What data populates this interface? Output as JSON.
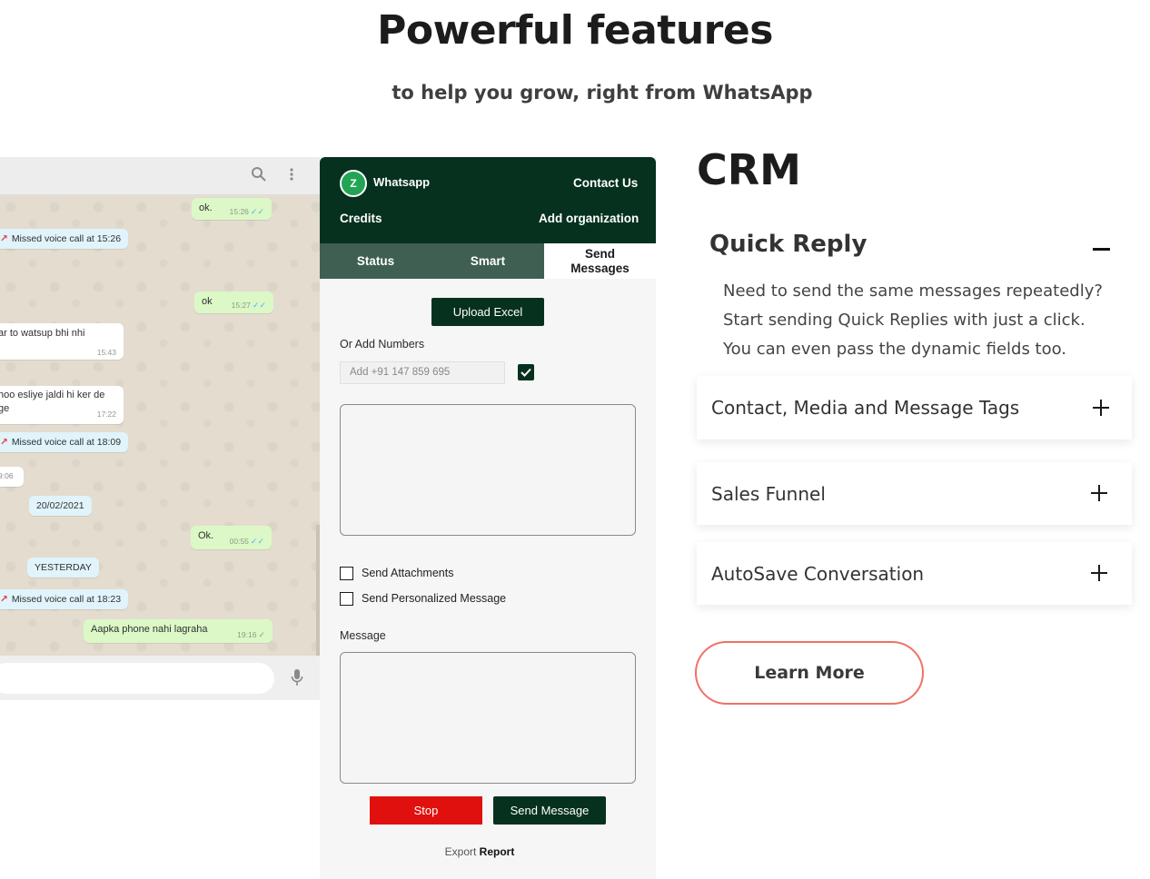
{
  "hero": {
    "title": "Powerful features",
    "subtitle": "to help you grow, right from WhatsApp"
  },
  "chat": {
    "messages": [
      {
        "kind": "out",
        "text": "ok.",
        "time": "15:26"
      },
      {
        "kind": "sys",
        "text": "Missed voice call at 15:26"
      },
      {
        "kind": "out",
        "text": "ok",
        "time": "15:27"
      },
      {
        "kind": "in",
        "text": "ar to watsup bhi nhi",
        "time": "15:43"
      },
      {
        "kind": "in",
        "text": "hoo esliye jaldi hi ker de",
        "text2": "ge",
        "time": "17:22"
      },
      {
        "kind": "sys",
        "text": "Missed voice call at 18:09"
      },
      {
        "kind": "in",
        "text": "9:06"
      },
      {
        "kind": "date",
        "text": "20/02/2021"
      },
      {
        "kind": "out",
        "text": "Ok.",
        "time": "00:55"
      },
      {
        "kind": "date",
        "text": "YESTERDAY"
      },
      {
        "kind": "sys",
        "text": "Missed voice call at 18:23"
      },
      {
        "kind": "out",
        "text": "Aapka phone nahi lagraha",
        "time": "19:16"
      }
    ]
  },
  "panel": {
    "brand_letter": "Z",
    "brand": "Whatsapp",
    "contact_us": "Contact Us",
    "credits": "Credits",
    "add_org": "Add organization",
    "tabs": [
      "Status",
      "Smart",
      "Send Messages"
    ],
    "upload_excel": "Upload Excel",
    "or_add_numbers": "Or Add Numbers",
    "numbers_placeholder": "Add +91 147 859 695",
    "send_attachments": "Send Attachments",
    "send_personalized": "Send Personalized Message",
    "message_label": "Message",
    "stop": "Stop",
    "send_message": "Send Message",
    "export": "Export",
    "report": "Report"
  },
  "crm": {
    "title": "CRM",
    "quick_reply": {
      "title": "Quick Reply",
      "lines": [
        "Need to send the same messages repeatedly?",
        "Start sending Quick Replies with just a click.",
        "You can even pass the dynamic fields too."
      ]
    },
    "items": [
      "Contact, Media and Message Tags",
      "Sales Funnel",
      "AutoSave Conversation"
    ],
    "learn_more": "Learn More"
  },
  "icons": {
    "search": "search-icon",
    "menu": "kebab-menu-icon",
    "mic": "microphone-icon",
    "missed_call": "missed-call-icon",
    "check": "checkmark-icon",
    "plus": "plus-icon",
    "minus": "minus-icon"
  },
  "colors": {
    "panel_header": "#05311e",
    "tab_bar": "#3e5f52",
    "stop_red": "#e0100e",
    "learn_more_border": "#f07165",
    "bubble_out": "#dcf8c6"
  }
}
